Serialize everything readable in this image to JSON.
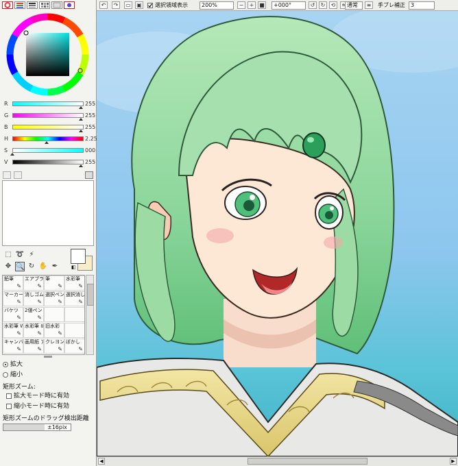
{
  "colors": {
    "accent": "#c02020",
    "panel": "#f3f3f0",
    "primary_color": "#ffffff",
    "secondary_color": "#f6eec8"
  },
  "color_panel": {
    "tabs": [
      "color-wheel-icon",
      "rgb-sliders-icon",
      "hsv-sliders-icon",
      "swatch-icon",
      "scratchpad-icon",
      "brush-color-icon"
    ],
    "sliders": [
      {
        "label": "R",
        "value": "255"
      },
      {
        "label": "G",
        "value": "255"
      },
      {
        "label": "B",
        "value": "255"
      },
      {
        "label": "H",
        "value": "2.252"
      },
      {
        "label": "S",
        "value": "000"
      },
      {
        "label": "V",
        "value": "255"
      }
    ],
    "fractions": [
      1.0,
      1.0,
      1.0,
      0.5,
      0.0,
      1.0
    ]
  },
  "tools": {
    "icons": [
      "rect-select-icon",
      "lasso-icon",
      "magic-wand-icon",
      "move-icon",
      "zoom-icon",
      "rotate-icon",
      "hand-icon",
      "eyedropper-icon"
    ],
    "selected": "zoom-icon"
  },
  "brushes": [
    {
      "label": "鉛筆",
      "icon": "pencil-icon"
    },
    {
      "label": "エアブラシ",
      "icon": "airbrush-icon"
    },
    {
      "label": "筆",
      "icon": "brush-icon"
    },
    {
      "label": "水彩筆",
      "icon": "watercolor-icon"
    },
    {
      "label": "マーカー",
      "icon": "marker-icon"
    },
    {
      "label": "消しゴム",
      "icon": "eraser-icon"
    },
    {
      "label": "選択ペン",
      "icon": "select-pen-icon"
    },
    {
      "label": "選択消し",
      "icon": "select-erase-icon"
    },
    {
      "label": "バケツ",
      "icon": "bucket-icon"
    },
    {
      "label": "2値ペン",
      "icon": "binary-pen-icon"
    },
    {
      "label": "",
      "icon": ""
    },
    {
      "label": "",
      "icon": ""
    },
    {
      "label": "水彩筆 Wet",
      "icon": "wet-brush-icon"
    },
    {
      "label": "水彩筆 IL",
      "icon": "il-brush-icon"
    },
    {
      "label": "旧水彩",
      "icon": "old-watercolor-icon"
    },
    {
      "label": "",
      "icon": ""
    },
    {
      "label": "キャンバス アクリル",
      "icon": "acrylic-icon"
    },
    {
      "label": "画用紙 アクリル",
      "icon": "paper-acrylic-icon"
    },
    {
      "label": "クレヨン",
      "icon": "crayon-icon"
    },
    {
      "label": "ぼかし",
      "icon": "blur-icon"
    }
  ],
  "zoom_options": {
    "zoom_in": "拡大",
    "zoom_out": "縮小",
    "rect_zoom_title": "矩形ズーム:",
    "check_zoom_in": "拡大モード時に有効",
    "check_zoom_out": "縮小モード時に有効",
    "drag_threshold_label": "矩形ズームのドラッグ検出距離",
    "drag_threshold_value": "±16pix"
  },
  "toolbar": {
    "show_selection_label": "選択領域表示",
    "zoom_value": "200%",
    "rotation_value": "+000°",
    "blend_mode": "通常",
    "stabilizer_label": "手ブレ補正",
    "stabilizer_value": "3"
  }
}
